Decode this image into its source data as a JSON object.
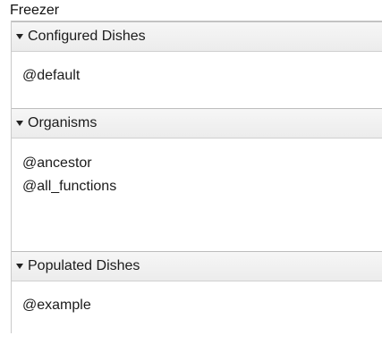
{
  "panel": {
    "title": "Freezer"
  },
  "sections": [
    {
      "label": "Configured Dishes",
      "expanded": true,
      "items": [
        "@default"
      ]
    },
    {
      "label": "Organisms",
      "expanded": true,
      "items": [
        "@ancestor",
        "@all_functions"
      ]
    },
    {
      "label": "Populated Dishes",
      "expanded": true,
      "items": [
        "@example"
      ]
    }
  ],
  "icons": {
    "section_toggle": "caret-down-icon"
  },
  "colors": {
    "header_bg": "#efefef",
    "border": "#c9c9c9",
    "text": "#1b1b1b"
  }
}
